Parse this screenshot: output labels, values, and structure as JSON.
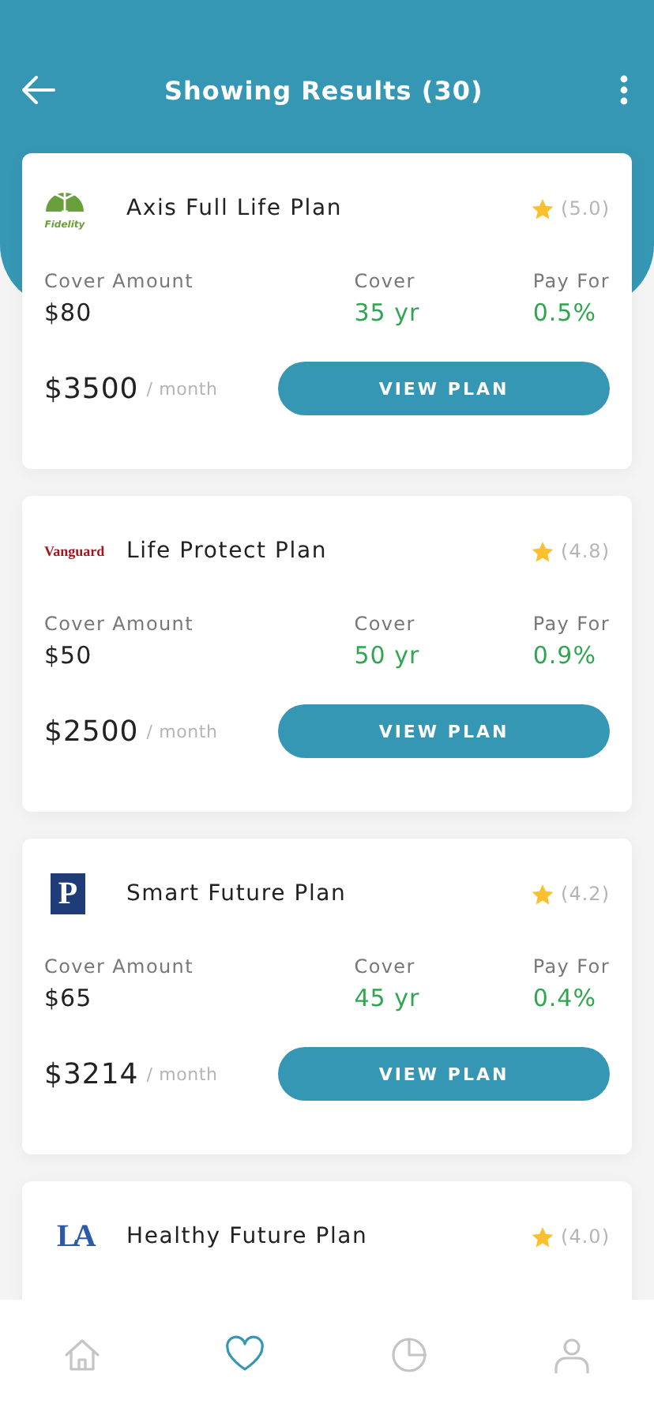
{
  "header": {
    "title": "Showing Results (30)"
  },
  "plans": [
    {
      "logo": {
        "kind": "fidelity",
        "text": "Fidelity"
      },
      "name": "Axis Full Life Plan",
      "rating": "(5.0)",
      "stats": [
        {
          "label": "Cover Amount",
          "value": "$80",
          "highlight": false
        },
        {
          "label": "Cover",
          "value": "35 yr",
          "highlight": true
        },
        {
          "label": "Pay For",
          "value": "0.5%",
          "highlight": true
        }
      ],
      "price": "$3500",
      "period": "/ month",
      "button": "VIEW PLAN"
    },
    {
      "logo": {
        "kind": "wordmark",
        "text": "Vanguard"
      },
      "name": "Life Protect Plan",
      "rating": "(4.8)",
      "stats": [
        {
          "label": "Cover Amount",
          "value": "$50",
          "highlight": false
        },
        {
          "label": "Cover",
          "value": "50 yr",
          "highlight": true
        },
        {
          "label": "Pay For",
          "value": "0.9%",
          "highlight": true
        }
      ],
      "price": "$2500",
      "period": "/ month",
      "button": "VIEW PLAN"
    },
    {
      "logo": {
        "kind": "square",
        "text": "P"
      },
      "name": "Smart Future Plan",
      "rating": "(4.2)",
      "stats": [
        {
          "label": "Cover Amount",
          "value": "$65",
          "highlight": false
        },
        {
          "label": "Cover",
          "value": "45 yr",
          "highlight": true
        },
        {
          "label": "Pay For",
          "value": "0.4%",
          "highlight": true
        }
      ],
      "price": "$3214",
      "period": "/ month",
      "button": "VIEW PLAN"
    },
    {
      "logo": {
        "kind": "monogram",
        "text": "LA"
      },
      "name": "Healthy Future Plan",
      "rating": "(4.0)"
    }
  ],
  "nav": [
    {
      "kind": "home",
      "selected": false
    },
    {
      "kind": "heart",
      "selected": true
    },
    {
      "kind": "chart",
      "selected": false
    },
    {
      "kind": "profile",
      "selected": false
    }
  ]
}
